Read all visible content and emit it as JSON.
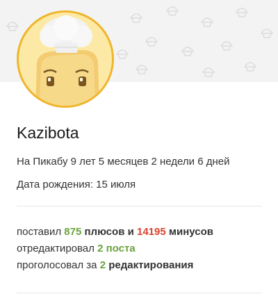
{
  "profile": {
    "username": "Kazibota",
    "membership": "На Пикабу 9 лет 5 месяцев 2 недели 6 дней",
    "birthday": "Дата рождения: 15 июля"
  },
  "stats": {
    "rated_prefix": "поставил",
    "pluses_count": "875",
    "pluses_label": "плюсов и",
    "minuses_count": "14195",
    "minuses_label": "минусов",
    "edited_prefix": "отредактировал",
    "edited_count": "2 поста",
    "voted_prefix": "проголосовал за",
    "voted_count": "2",
    "voted_label": "редактирования"
  },
  "colors": {
    "positive": "#6aa23b",
    "negative": "#d9432f",
    "avatar_border": "#efb52a"
  },
  "icons": {
    "avatar": "chef-hat-bread-mascot",
    "banner_pattern": "cupcake-pattern"
  }
}
